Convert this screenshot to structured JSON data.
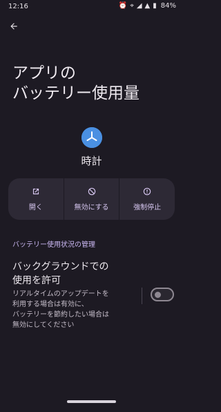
{
  "status": {
    "time": "12:16",
    "battery": "84%",
    "icons": [
      "alarm-icon",
      "location-icon",
      "wifi-icon",
      "signal-icon",
      "battery-icon"
    ]
  },
  "page": {
    "title": "アプリの\nバッテリー使用量",
    "app_name": "時計"
  },
  "actions": [
    {
      "label": "開く",
      "icon": "open-icon"
    },
    {
      "label": "無効にする",
      "icon": "disable-icon"
    },
    {
      "label": "強制停止",
      "icon": "force-stop-icon"
    }
  ],
  "section": {
    "header": "バッテリー使用状況の管理",
    "setting_title": "バックグラウンドでの\n使用を許可",
    "setting_summary": "リアルタイムのアップデートを\n利用する場合は有効に、\nバッテリーを節約したい場合は\n無効にしてください",
    "toggle_state": "off"
  },
  "colors": {
    "background": "#1d1a23",
    "accent": "#cbb8f3",
    "card": "#2d2935",
    "app_icon": "#4a90e2"
  }
}
